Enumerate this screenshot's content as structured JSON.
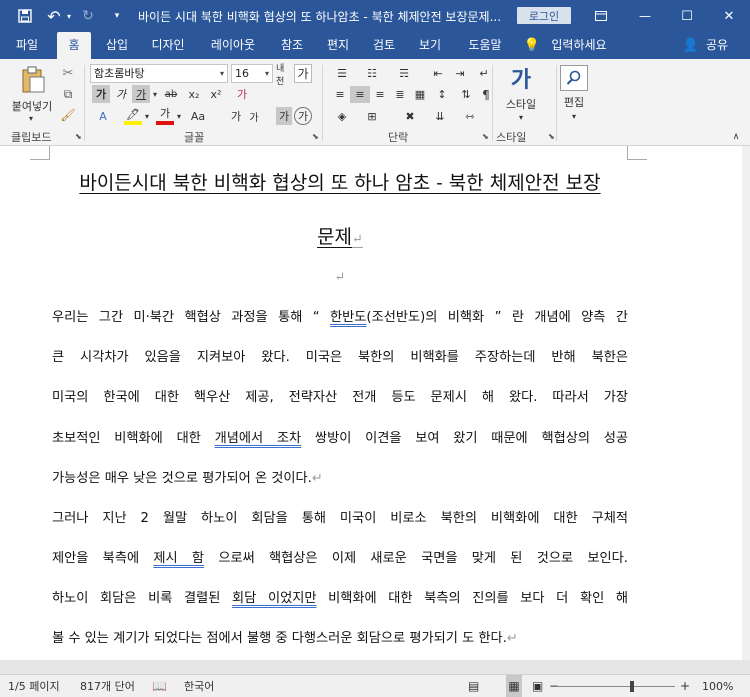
{
  "window": {
    "title": "바이든 시대 북한 비핵화 협상의 또 하나암초 - 북한 체제안전 보장문제...",
    "login_label": "로그인",
    "save_glyph": "💾",
    "undo_glyph": "↶",
    "redo_glyph": "↻",
    "more_glyph": "▾",
    "restore_glyph": "▭",
    "minimize_glyph": "—",
    "maximize_glyph": "☐",
    "close_glyph": "✕"
  },
  "tabs": [
    "파일",
    "홈",
    "삽입",
    "디자인",
    "레이아웃",
    "참조",
    "편지",
    "검토",
    "보기",
    "도움말"
  ],
  "active_tab": "홈",
  "tell_me": "입력하세요",
  "share_label": "공유",
  "ribbon": {
    "clipboard": {
      "paste_label": "붙여넣기",
      "group_label": "클립보드"
    },
    "font": {
      "font_name": "함초롬바탕",
      "font_size": "16",
      "group_label": "글꼴",
      "buttons": [
        "가",
        "가",
        "가",
        "ab",
        "x₂",
        "x²",
        "가",
        "가",
        "Aa",
        "가",
        "가",
        "가",
        "가",
        "가",
        "가"
      ]
    },
    "paragraph": {
      "group_label": "단락"
    },
    "styles": {
      "button_label": "스타일",
      "group_label": "스타일"
    },
    "editing": {
      "button_label": "편집"
    }
  },
  "document": {
    "title_line1": "바이든시대 북한 비핵화 협상의 또 하나 암초 - 북한 체제안전 보장",
    "title_line2": "문제",
    "paragraph_mark": "↵",
    "lines": [
      {
        "pre": "우리는 그간 미·북간 핵협상 과정을 통해 “ ",
        "sq": "한반도",
        "post": "(조선반도)의 비핵화 ” 란 개념에 양측 간"
      },
      {
        "pre": "큰 시각차가 있음을 지켜보아 왔다. 미국은 북한의 비핵화를 주장하는데 반해 북한은",
        "sq": "",
        "post": ""
      },
      {
        "pre": "미국의 한국에 대한 핵우산 제공, 전략자산 전개 등도 문제시 해 왔다. 따라서 가장",
        "sq": "",
        "post": ""
      },
      {
        "pre": "초보적인 비핵화에 대한 ",
        "sq": "개념에서 조차",
        "post": " 쌍방이 이견을 보여 왔기 때문에 핵협상의 성공"
      },
      {
        "pre": "가능성은 매우 낮은 것으로 평가되어 온 것이다.",
        "sq": "",
        "post": "",
        "end": "↵"
      },
      {
        "pre": "그러나 지난 2 월말 하노이 회담을 통해 미국이 비로소 북한의 비핵화에 대한 구체적",
        "sq": "",
        "post": ""
      },
      {
        "pre": "제안을 북측에 ",
        "sq": "제시 함",
        "post": " 으로써 핵협상은 이제 새로운 국면을 맞게 된 것으로 보인다."
      },
      {
        "pre": "하노이 회담은 비록 결렬된 ",
        "sq": "회담 이었지만",
        "post": " 비핵화에 대한 북측의 진의를 보다 더 확인 해"
      },
      {
        "pre": "볼 수 있는 계기가 되었다는 점에서 불행 중 다행스러운 회담으로 평가되기 도 한다.",
        "sq": "",
        "post": "",
        "end": "↵"
      }
    ]
  },
  "status": {
    "page": "1/5 페이지",
    "words": "817개 단어",
    "language": "한국어",
    "zoom": "100%",
    "zoom_minus": "−",
    "zoom_plus": "+",
    "zoom_level": 1.0
  }
}
